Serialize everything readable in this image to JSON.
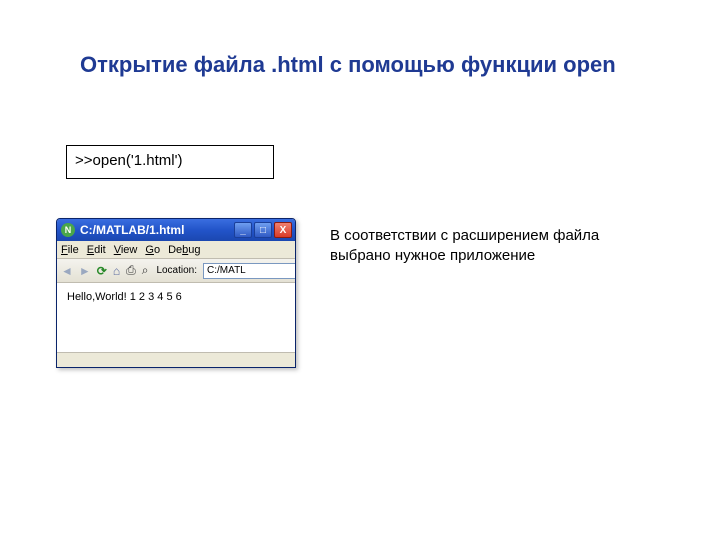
{
  "slide": {
    "title": "Открытие файла .html с помощью функции open"
  },
  "code": {
    "command": ">>open('1.html')"
  },
  "explanation": {
    "text": "В соответствии с расширением файла выбрано нужное приложение"
  },
  "browser": {
    "title": "C:/MATLAB/1.html",
    "favicon_letter": "N",
    "buttons": {
      "min": "_",
      "max": "□",
      "close": "X"
    },
    "menus": {
      "file": "File",
      "edit": "Edit",
      "view": "View",
      "go": "Go",
      "debug": "Debug"
    },
    "toolbar": {
      "back": "◄",
      "forward": "►",
      "reload": "⟳",
      "home": "⌂",
      "print": "⎙",
      "find": "⌕",
      "location_label": "Location:",
      "location_value": "C:/MATL",
      "dropdown": "▾"
    },
    "page_content": "Hello,World! 1 2 3 4 5 6"
  }
}
